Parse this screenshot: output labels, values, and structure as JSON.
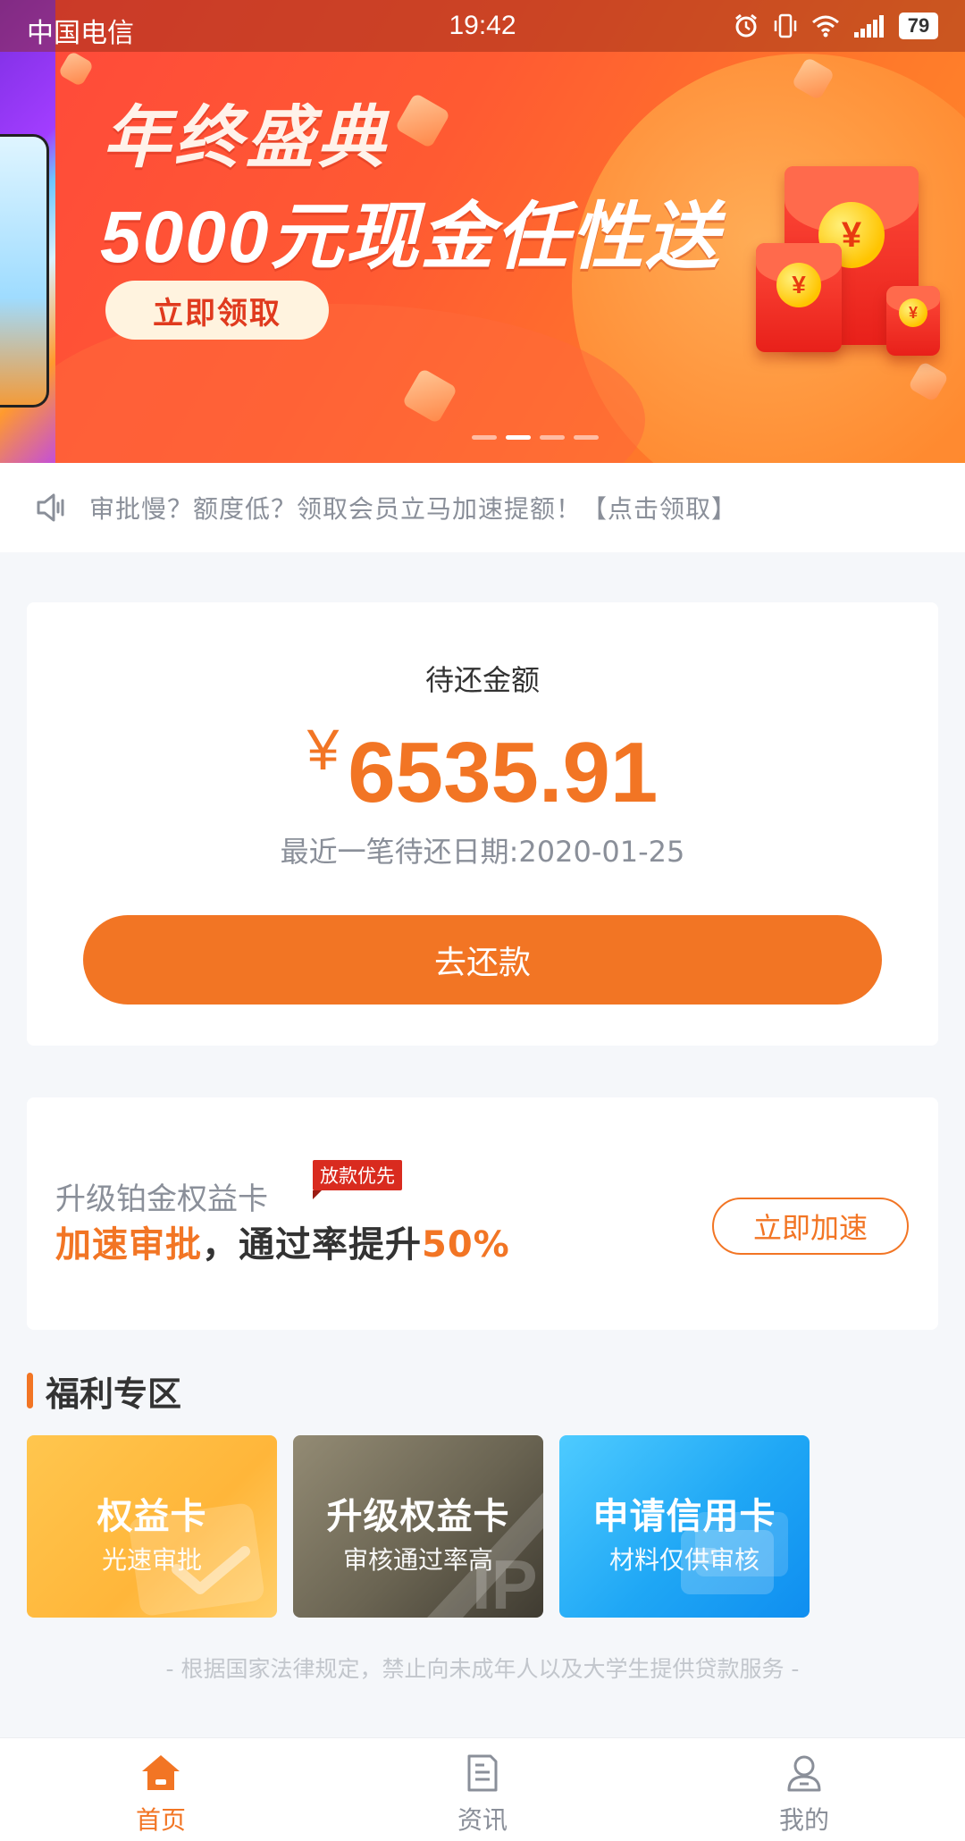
{
  "status_bar": {
    "carrier": "中国电信",
    "time": "19:42",
    "battery": "79"
  },
  "banner": {
    "title": "年终盛典",
    "subtitle": "5000元现金任性送",
    "button_label": "立即领取",
    "envelope_symbol": "¥",
    "slide_count": 4,
    "active_slide": 2
  },
  "notice": {
    "icon": "speaker-icon",
    "text": "审批慢？额度低？领取会员立马加速提额！【点击领取】"
  },
  "repay": {
    "label": "待还金额",
    "currency": "¥",
    "amount": "6535.91",
    "date_text": "最近一笔待还日期:2020-01-25",
    "button_label": "去还款"
  },
  "upgrade": {
    "line1": "升级铂金权益卡",
    "tag": "放款优先",
    "line2_highlight": "加速审批",
    "line2_middle": "，通过率提升",
    "line2_percent": "50%",
    "button_label": "立即加速"
  },
  "welfare": {
    "title": "福利专区",
    "tiles": [
      {
        "title": "权益卡",
        "subtitle": "光速审批"
      },
      {
        "title": "升级权益卡",
        "subtitle": "审核通过率高"
      },
      {
        "title": "申请信用卡",
        "subtitle": "材料仅供审核"
      }
    ]
  },
  "disclaimer": "- 根据国家法律规定，禁止向未成年人以及大学生提供贷款服务 -",
  "tabbar": {
    "items": [
      {
        "label": "首页",
        "icon": "home-icon",
        "active": true
      },
      {
        "label": "资讯",
        "icon": "news-icon",
        "active": false
      },
      {
        "label": "我的",
        "icon": "user-icon",
        "active": false
      }
    ]
  },
  "colors": {
    "accent": "#f27524",
    "banner_red": "#ff4a3a",
    "tag_red": "#d92b1f",
    "tile_yellow": "#ffbe45",
    "tile_bronze": "#6a6452",
    "tile_blue": "#1fa7f5"
  }
}
